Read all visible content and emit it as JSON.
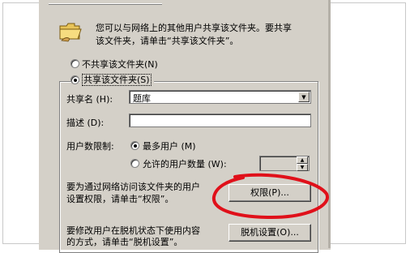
{
  "dialog": {
    "info_text_line1": "您可以与网络上的其他用户共享该文件夹。要共享",
    "info_text_line2": "该文件夹，请单击“共享该文件夹”。",
    "radio_not_share": "不共享该文件夹",
    "radio_not_share_key": "(N)",
    "radio_share": "共享该文件夹",
    "radio_share_key": "(S)",
    "share_name_label": "共享名",
    "share_name_key": "(H):",
    "share_name_value": "题库",
    "description_label": "描述",
    "description_key": "(D):",
    "description_value": "",
    "user_limit_label": "用户数限制:",
    "max_users_label": "最多用户",
    "max_users_key": "(M)",
    "allowed_users_label": "允许的用户数量",
    "allowed_users_key": "(W):",
    "allowed_users_value": "",
    "permissions_text_line1": "要为通过网络访问该文件夹的用户",
    "permissions_text_line2": "设置权限，请单击“权限”。",
    "permissions_button": "权限(P)...",
    "offline_text_line1": "要修改用户在脱机状态下使用内容",
    "offline_text_line2": "的方式，请单击“脱机设置”。",
    "offline_button": "脱机设置(O)...",
    "selected_option": "share",
    "selected_limit": "max"
  },
  "annotation": {
    "color": "#e0101a"
  }
}
